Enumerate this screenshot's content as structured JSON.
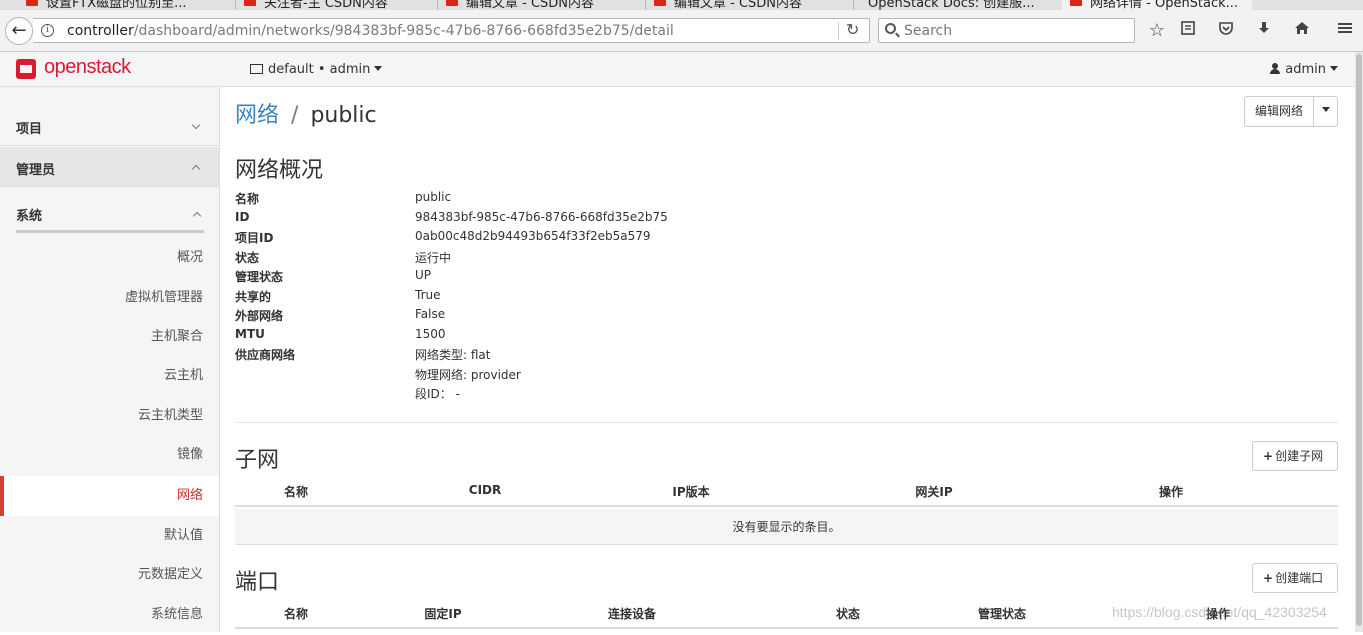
{
  "browser": {
    "tabs": [
      {
        "label": "设置FTX磁盘的位别至...",
        "favicon": "red"
      },
      {
        "label": "关注者-主 CSDN内容",
        "favicon": "red"
      },
      {
        "label": "编辑文章 - CSDN内容",
        "favicon": "red"
      },
      {
        "label": "编辑文章 - CSDN内容",
        "favicon": "red"
      },
      {
        "label": "OpenStack Docs: 创建服...",
        "favicon": "none"
      },
      {
        "label": "网络详情 - OpenStack...",
        "favicon": "red"
      }
    ],
    "url_host": "controller",
    "url_path": "/dashboard/admin/networks/984383bf-985c-47b6-8766-668fd35e2b75/detail",
    "search_placeholder": "Search"
  },
  "header": {
    "logo": "openstack",
    "project_selector": "default • admin",
    "user_menu": "admin"
  },
  "sidebar": {
    "groups": [
      {
        "label": "项目",
        "expanded": false
      },
      {
        "label": "管理员",
        "expanded": true
      }
    ],
    "subgroup": "系统",
    "items": [
      {
        "label": "概况",
        "active": false
      },
      {
        "label": "虚拟机管理器",
        "active": false
      },
      {
        "label": "主机聚合",
        "active": false
      },
      {
        "label": "云主机",
        "active": false
      },
      {
        "label": "云主机类型",
        "active": false
      },
      {
        "label": "镜像",
        "active": false
      },
      {
        "label": "网络",
        "active": true
      },
      {
        "label": "默认值",
        "active": false
      },
      {
        "label": "元数据定义",
        "active": false
      },
      {
        "label": "系统信息",
        "active": false
      }
    ]
  },
  "page": {
    "breadcrumb_parent": "网络",
    "breadcrumb_separator": "/",
    "title": "public",
    "edit_button": "编辑网络",
    "overview_title": "网络概况",
    "overview": [
      {
        "key": "名称",
        "value": "public"
      },
      {
        "key": "ID",
        "value": "984383bf-985c-47b6-8766-668fd35e2b75"
      },
      {
        "key": "项目ID",
        "value": "0ab00c48d2b94493b654f33f2eb5a579"
      },
      {
        "key": "状态",
        "value": "运行中"
      },
      {
        "key": "管理状态",
        "value": "UP"
      },
      {
        "key": "共享的",
        "value": "True"
      },
      {
        "key": "外部网络",
        "value": "False"
      },
      {
        "key": "MTU",
        "value": "1500"
      },
      {
        "key": "供应商网络",
        "value": "网络类型: flat"
      },
      {
        "key": "",
        "value": "物理网络: provider"
      },
      {
        "key": "",
        "value": "段ID： -"
      }
    ],
    "subnets": {
      "title": "子网",
      "create_button": "创建子网",
      "columns": [
        "名称",
        "CIDR",
        "IP版本",
        "网关IP",
        "操作"
      ],
      "empty_text": "没有要显示的条目。"
    },
    "ports": {
      "title": "端口",
      "create_button": "创建端口",
      "columns": [
        "名称",
        "固定IP",
        "连接设备",
        "状态",
        "管理状态",
        "操作"
      ]
    }
  },
  "watermark": "https://blog.csdn.net/qq_42303254"
}
